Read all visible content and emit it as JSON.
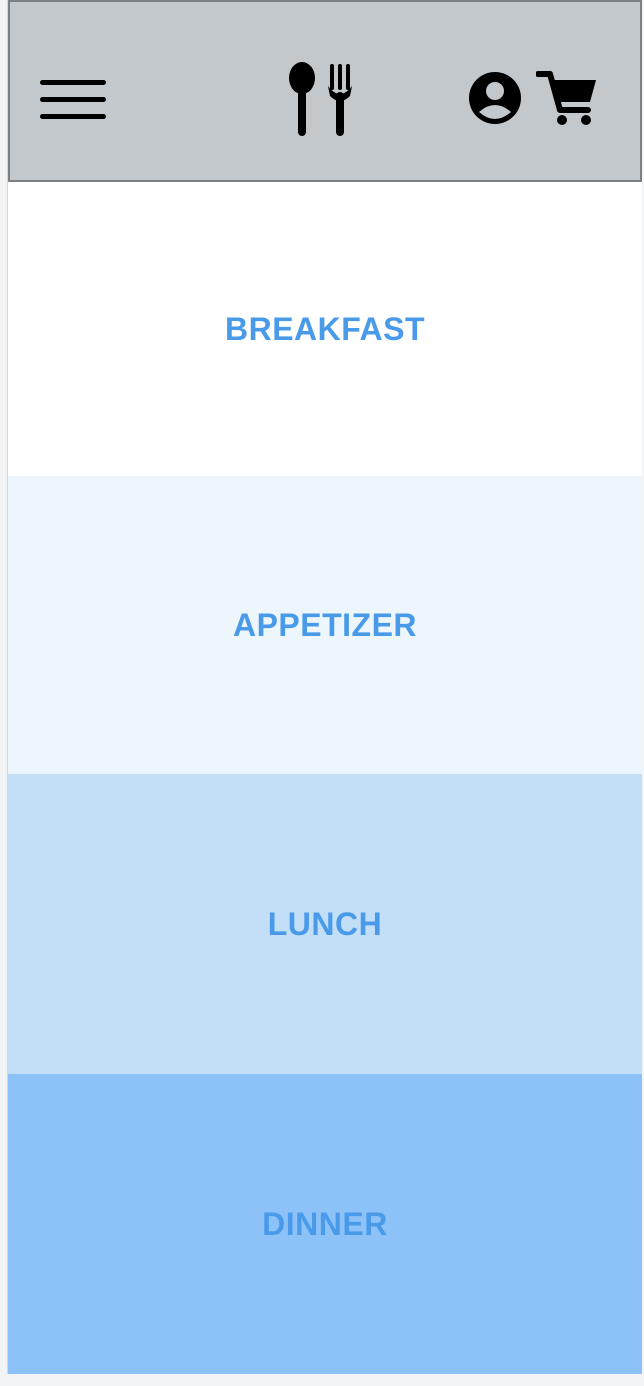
{
  "header": {
    "menu_icon": "hamburger-menu-icon",
    "logo_icon": "spoon-fork-icon",
    "account_icon": "account-circle-icon",
    "cart_icon": "shopping-cart-icon"
  },
  "sections": [
    {
      "label": "BREAKFAST",
      "background": "#ffffff"
    },
    {
      "label": "APPETIZER",
      "background": "#eef6fd"
    },
    {
      "label": "LUNCH",
      "background": "#c2dff7"
    },
    {
      "label": "DINNER",
      "background": "#8dc2f8"
    }
  ],
  "colors": {
    "header_bg": "#c3c8cc",
    "label_text": "#4a9aea"
  }
}
